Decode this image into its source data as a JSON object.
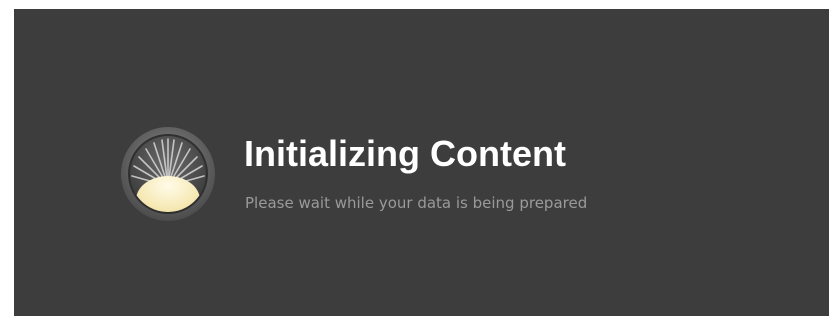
{
  "loading_panel": {
    "title": "Initializing Content",
    "subtitle": "Please wait while your data is being prepared",
    "icon": "sunrise-icon"
  },
  "colors": {
    "panel_background": "#3d3d3d",
    "title_text": "#ffffff",
    "subtitle_text": "#9a9a9a",
    "icon_ring": "#6e6e6e",
    "icon_sun": "#f6e9b4"
  }
}
